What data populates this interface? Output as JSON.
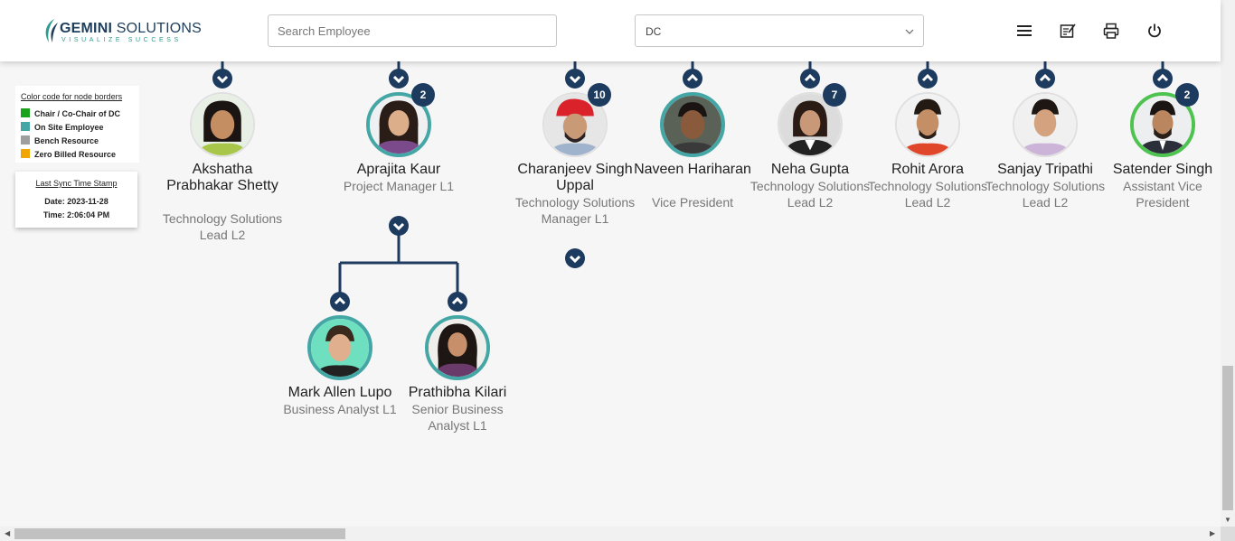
{
  "header": {
    "logo_main": "GEMINI",
    "logo_second": "SOLUTIONS",
    "logo_tagline": "VISUALIZE SUCCESS",
    "search_placeholder": "Search Employee",
    "dropdown_value": "DC",
    "icons": [
      "menu-icon",
      "notes-icon",
      "print-icon",
      "power-icon"
    ]
  },
  "legend": {
    "title": "Color code for node borders",
    "items": [
      {
        "label": "Chair / Co-Chair of DC",
        "color": "#1aa31a"
      },
      {
        "label": "On Site Employee",
        "color": "#45a6a6"
      },
      {
        "label": "Bench Resource",
        "color": "#9e9e9e"
      },
      {
        "label": "Zero Billed Resource",
        "color": "#f0a500"
      }
    ]
  },
  "sync": {
    "title": "Last Sync Time Stamp",
    "date": "Date: 2023-11-28",
    "time": "Time: 2:06:04 PM"
  },
  "colors": {
    "node_navy": "#1d3a5f",
    "onsite_teal": "#45a6a6",
    "chair_green": "#4fc34f",
    "bench_grey": "#9e9e9e"
  },
  "employees": [
    {
      "name": "Akshatha Prabhakar Shetty",
      "title": "Technology Solutions Lead L2",
      "count": "",
      "border": "none"
    },
    {
      "name": "Aprajita Kaur",
      "title": "Project Manager L1",
      "count": "2",
      "border": "onsite"
    },
    {
      "name": "Charanjeev Singh Uppal",
      "title": "Technology Solutions Manager L1",
      "count": "10",
      "border": "none"
    },
    {
      "name": "Naveen Hariharan",
      "title": "Vice President",
      "count": "",
      "border": "onsite"
    },
    {
      "name": "Neha Gupta",
      "title": "Technology Solutions Lead L2",
      "count": "7",
      "border": "none"
    },
    {
      "name": "Rohit Arora",
      "title": "Technology Solutions Lead L2",
      "count": "",
      "border": "none"
    },
    {
      "name": "Sanjay Tripathi",
      "title": "Technology Solutions Lead L2",
      "count": "",
      "border": "none"
    },
    {
      "name": "Satender Singh",
      "title": "Assistant Vice President",
      "count": "2",
      "border": "chair"
    },
    {
      "name": "Mark Allen Lupo",
      "title": "Business Analyst L1",
      "count": "",
      "border": "onsite"
    },
    {
      "name": "Prathibha Kilari",
      "title": "Senior Business Analyst L1",
      "count": "",
      "border": "onsite"
    }
  ]
}
